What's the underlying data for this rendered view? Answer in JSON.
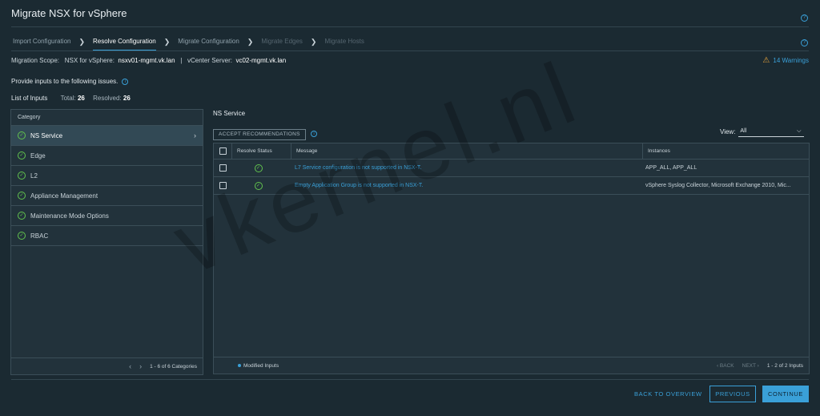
{
  "header": {
    "title": "Migrate NSX for vSphere"
  },
  "steps": [
    {
      "label": "Import Configuration",
      "state": "done"
    },
    {
      "label": "Resolve Configuration",
      "state": "active"
    },
    {
      "label": "Migrate Configuration",
      "state": "done"
    },
    {
      "label": "Migrate Edges",
      "state": "disabled"
    },
    {
      "label": "Migrate Hosts",
      "state": "disabled"
    }
  ],
  "scope": {
    "label": "Migration Scope:",
    "nsx_label": "NSX for vSphere:",
    "nsx_value": "nsxv01-mgmt.vk.lan",
    "separator": "|",
    "vc_label": "vCenter Server:",
    "vc_value": "vc02-mgmt.vk.lan"
  },
  "warnings": {
    "label": "14 Warnings"
  },
  "provide_text": "Provide inputs to the following issues.",
  "inputs": {
    "title": "List of Inputs",
    "total_label": "Total:",
    "total_value": "26",
    "resolved_label": "Resolved:",
    "resolved_value": "26"
  },
  "categories": {
    "header": "Category",
    "items": [
      "NS Service",
      "Edge",
      "L2",
      "Appliance Management",
      "Maintenance Mode Options",
      "RBAC"
    ],
    "pagination": "1 - 6 of 6 Categories"
  },
  "ns_service": {
    "title": "NS Service",
    "accept_button": "ACCEPT RECOMMENDATIONS",
    "view_label": "View:",
    "view_value": "All",
    "columns": [
      "Resolve Status",
      "Message",
      "Instances"
    ],
    "rows": [
      {
        "message": "L7 Service configuration is not supported in NSX-T.",
        "instances": "APP_ALL, APP_ALL"
      },
      {
        "message": "Empty Application Group is not supported in NSX-T.",
        "instances": "vSphere Syslog Collector, Microsoft Exchange 2010, Mic..."
      }
    ],
    "modified_label": "Modified Inputs",
    "back_label": "BACK",
    "next_label": "NEXT",
    "pagination": "1 - 2 of 2 Inputs"
  },
  "footer": {
    "back_to_overview": "BACK TO OVERVIEW",
    "previous": "PREVIOUS",
    "continue": "CONTINUE"
  },
  "watermark": "vkernel.nl",
  "colors": {
    "accent": "#3aa0d8",
    "success": "#62c34e",
    "warning": "#e8a33c",
    "background": "#1b2a32"
  }
}
